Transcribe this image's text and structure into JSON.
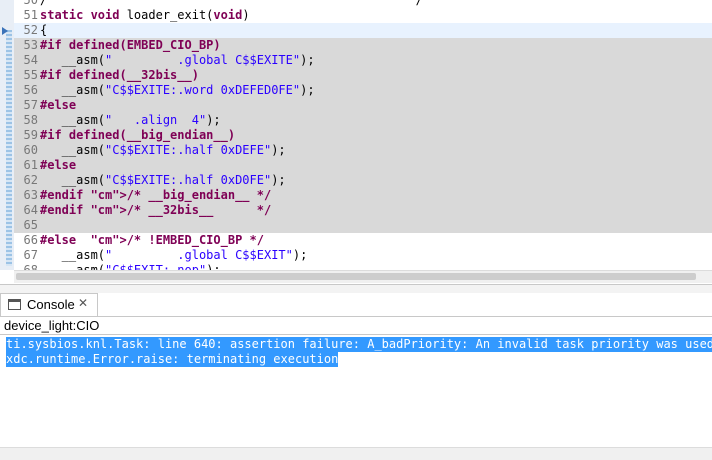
{
  "editor": {
    "lines": [
      {
        "num": "50",
        "text": "/                                                   /",
        "type": "comment",
        "state": "partial"
      },
      {
        "num": "51",
        "text": "static void loader_exit(void)",
        "type": "code",
        "state": "normal"
      },
      {
        "num": "52",
        "text": "{",
        "type": "code",
        "state": "cursor"
      },
      {
        "num": "53",
        "text": "#if defined(EMBED_CIO_BP)",
        "type": "directive",
        "state": "shaded"
      },
      {
        "num": "54",
        "text": "   __asm(\"         .global C$$EXITE\");",
        "type": "asm",
        "state": "shaded"
      },
      {
        "num": "55",
        "text": "#if defined(__32bis__)",
        "type": "directive",
        "state": "shaded"
      },
      {
        "num": "56",
        "text": "   __asm(\"C$$EXITE:.word 0xDEFED0FE\");",
        "type": "asm",
        "state": "shaded"
      },
      {
        "num": "57",
        "text": "#else",
        "type": "directive",
        "state": "shaded"
      },
      {
        "num": "58",
        "text": "   __asm(\"   .align  4\");",
        "type": "asm",
        "state": "shaded"
      },
      {
        "num": "59",
        "text": "#if defined(__big_endian__)",
        "type": "directive",
        "state": "shaded"
      },
      {
        "num": "60",
        "text": "   __asm(\"C$$EXITE:.half 0xDEFE\");",
        "type": "asm",
        "state": "shaded"
      },
      {
        "num": "61",
        "text": "#else",
        "type": "directive",
        "state": "shaded"
      },
      {
        "num": "62",
        "text": "   __asm(\"C$$EXITE:.half 0xD0FE\");",
        "type": "asm",
        "state": "shaded"
      },
      {
        "num": "63",
        "text": "#endif /* __big_endian__ */",
        "type": "directive",
        "state": "shaded"
      },
      {
        "num": "64",
        "text": "#endif /* __32bis__      */",
        "type": "directive",
        "state": "shaded"
      },
      {
        "num": "65",
        "text": "",
        "type": "code",
        "state": "shaded"
      },
      {
        "num": "66",
        "text": "#else  /* !EMBED_CIO_BP */",
        "type": "directive",
        "state": "normal"
      },
      {
        "num": "67",
        "text": "   __asm(\"         .global C$$EXIT\");",
        "type": "asm",
        "state": "normal"
      },
      {
        "num": "68",
        "text": "   __asm(\"C$$EXIT:.nop\");",
        "type": "asm",
        "state": "partial"
      }
    ]
  },
  "console": {
    "tab_label": "Console",
    "tab_close": "✕",
    "session_label": "device_light:CIO",
    "output": [
      "ti.sysbios.knl.Task: line 640: assertion failure: A_badPriority: An invalid task priority was used.",
      "xdc.runtime.Error.raise: terminating execution"
    ]
  },
  "colors": {
    "keyword": "#7f0055",
    "string": "#2a00ff",
    "comment": "#3f7f5f",
    "selection": "#3399ff",
    "shaded_block": "#d9d9d9"
  }
}
